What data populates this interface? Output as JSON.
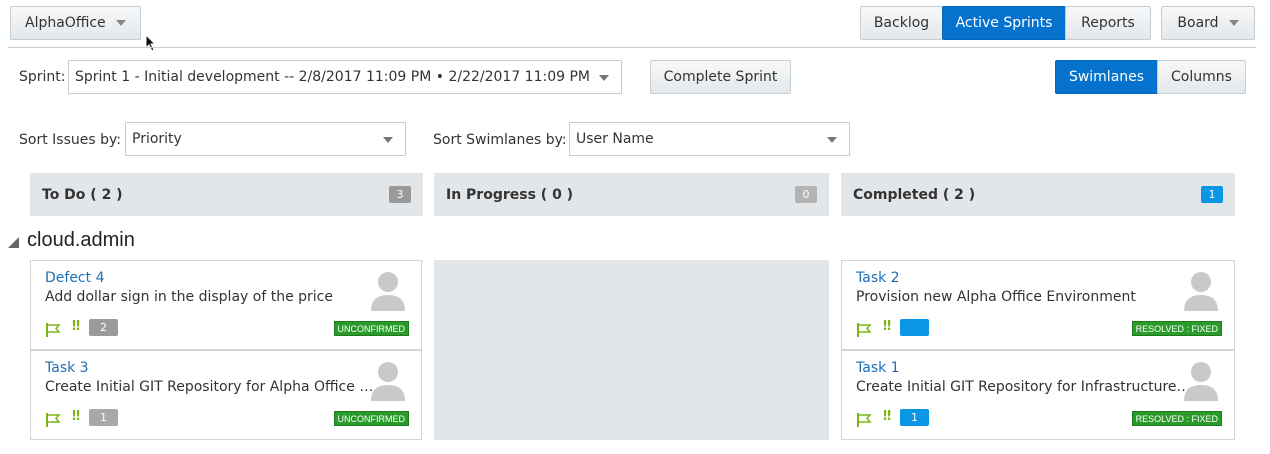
{
  "header": {
    "project_selector": "AlphaOffice",
    "nav": [
      "Backlog",
      "Active Sprints",
      "Reports"
    ],
    "board_menu": "Board"
  },
  "sprint": {
    "label": "Sprint:",
    "selected": "Sprint 1 - Initial development -- 2/8/2017 11:09 PM • 2/22/2017 11:09 PM",
    "complete_button": "Complete Sprint"
  },
  "view_toggle": [
    "Swimlanes",
    "Columns"
  ],
  "sorting": {
    "issues_label": "Sort Issues by:",
    "issues_value": "Priority",
    "swimlanes_label": "Sort Swimlanes by:",
    "swimlanes_value": "User Name"
  },
  "columns": [
    {
      "title": "To Do ( 2 )",
      "count": "3",
      "count_color": "#9a9a9a"
    },
    {
      "title": "In Progress ( 0 )",
      "count": "0",
      "count_color": "#b3b3b3"
    },
    {
      "title": "Completed ( 2 )",
      "count": "1",
      "count_color": "#0b96e5"
    }
  ],
  "swimlane": {
    "name": "cloud.admin",
    "todo_cards": [
      {
        "title": "Defect 4",
        "description": "Add dollar sign in the display of the price",
        "points": "2",
        "points_color": "#9a9a9a",
        "status": "UNCONFIRMED"
      },
      {
        "title": "Task 3",
        "description": "Create Initial GIT Repository for Alpha Office Application",
        "points": "1",
        "points_color": "#a8a8a8",
        "status": "UNCONFIRMED"
      }
    ],
    "completed_cards": [
      {
        "title": "Task 2",
        "description": "Provision new Alpha Office Environment",
        "points": "",
        "points_color": "#0b96e5",
        "status": "RESOLVED : FIXED"
      },
      {
        "title": "Task 1",
        "description": "Create Initial GIT Repository for Infrastructure Scripts",
        "points": "1",
        "points_color": "#0b96e5",
        "status": "RESOLVED : FIXED"
      }
    ]
  },
  "icons": {
    "priority_flag": "flag-icon",
    "priority_marker": "‼",
    "assignee": "avatar-icon",
    "swimlane_toggle": "triangle-icon"
  },
  "colors": {
    "accent": "#0572ce",
    "link": "#1f6fb5",
    "status_green": "#2a9b2a",
    "priority_green": "#7cb518"
  }
}
